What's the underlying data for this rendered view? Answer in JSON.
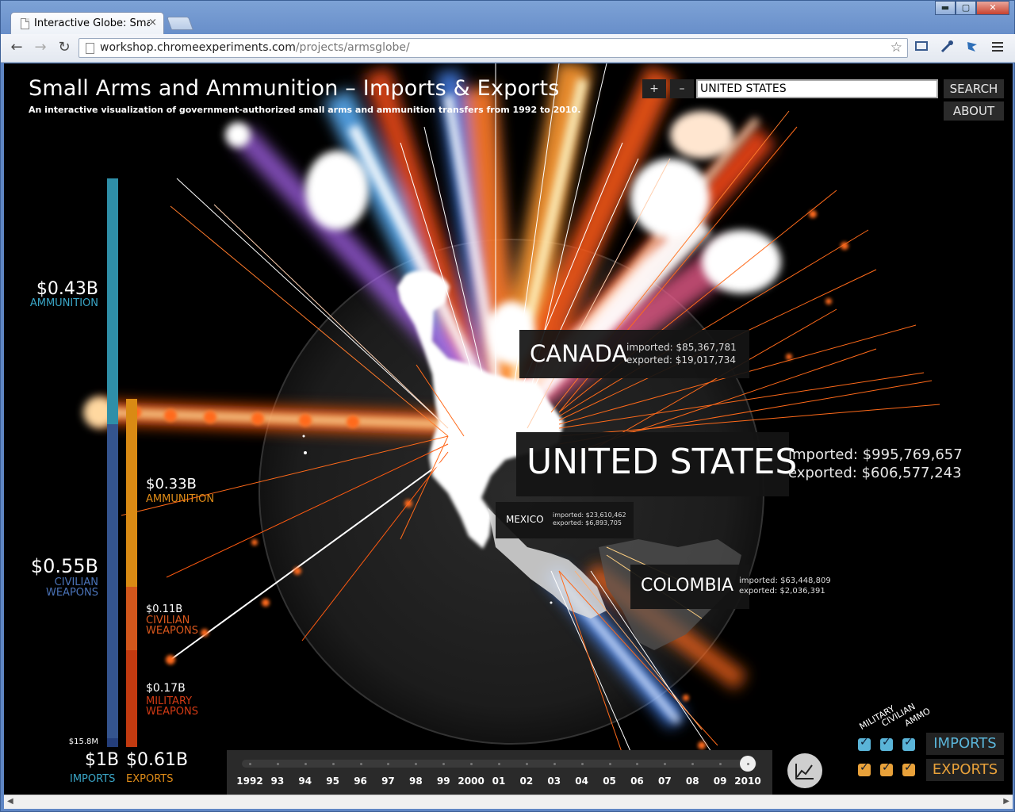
{
  "browser": {
    "tab_title": "Interactive Globe: Small",
    "tab_close": "×",
    "url_host": "workshop.chromeexperiments.com",
    "url_path": "/projects/armsglobe/",
    "win_minimize": "▬",
    "win_maximize": "▢",
    "win_close": "✕",
    "back": "←",
    "forward": "→",
    "reload": "↻",
    "star": "☆"
  },
  "app": {
    "title": "Small Arms and Ammunition – Imports & Exports",
    "subtitle": "An interactive visualization of government-authorized small arms and ammunition transfers from 1992 to 2010.",
    "zoom_in": "+",
    "zoom_out": "–",
    "search_value": "UNITED STATES",
    "search_label": "SEARCH",
    "about_label": "ABOUT"
  },
  "imports": {
    "ammunition_amount": "$0.43B",
    "ammunition_label": "AMMUNITION",
    "civilian_amount": "$0.55B",
    "civilian_label_1": "CIVILIAN",
    "civilian_label_2": "WEAPONS",
    "military_amount": "$15.8M",
    "total": "$1B",
    "total_label": "IMPORTS",
    "values_millions": {
      "ammunition": 430,
      "civilian": 550,
      "military": 15.8
    },
    "colors": {
      "ammunition": "#2f8fa8",
      "civilian": "#34548e",
      "military": "#243e7a"
    }
  },
  "exports": {
    "ammunition_amount": "$0.33B",
    "ammunition_label": "AMMUNITION",
    "civilian_amount": "$0.11B",
    "civilian_label_1": "CIVILIAN",
    "civilian_label_2": "WEAPONS",
    "military_amount": "$0.17B",
    "military_label_1": "MILITARY",
    "military_label_2": "WEAPONS",
    "total": "$0.61B",
    "total_label": "EXPORTS",
    "values_millions": {
      "ammunition": 330,
      "civilian": 110,
      "military": 170
    },
    "colors": {
      "ammunition": "#d98a14",
      "civilian": "#d2571c",
      "military": "#c23a10"
    }
  },
  "countries": {
    "canada": {
      "name": "CANADA",
      "imported": "imported: $85,367,781",
      "exported": "exported: $19,017,734"
    },
    "united_states": {
      "name": "UNITED STATES",
      "imported": "imported: $995,769,657",
      "exported": "exported: $606,577,243"
    },
    "mexico": {
      "name": "MEXICO",
      "imported": "imported: $23,610,462",
      "exported": "exported: $6,893,705"
    },
    "colombia": {
      "name": "COLOMBIA",
      "imported": "imported: $63,448,809",
      "exported": "exported: $2,036,391"
    }
  },
  "timeline": {
    "years": [
      "1992",
      "93",
      "94",
      "95",
      "96",
      "97",
      "98",
      "99",
      "2000",
      "01",
      "02",
      "03",
      "04",
      "05",
      "06",
      "07",
      "08",
      "09",
      "2010"
    ],
    "selected_year": "2010",
    "selected_index": 18
  },
  "filters": {
    "military": "MILITARY",
    "civilian": "CIVILIAN",
    "ammo": "AMMO",
    "imports_label": "IMPORTS",
    "exports_label": "EXPORTS",
    "check": "✓",
    "import_color": "#5ab4d8",
    "export_color": "#e8a13a",
    "imports_checked": [
      true,
      true,
      true
    ],
    "exports_checked": [
      true,
      true,
      true
    ]
  }
}
